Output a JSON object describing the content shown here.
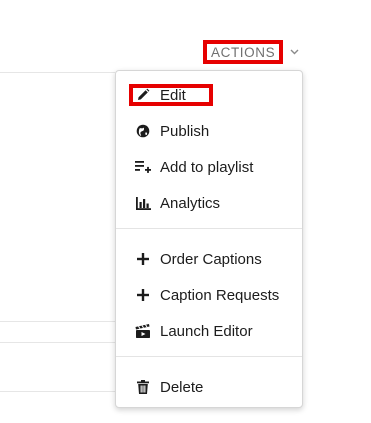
{
  "header": {
    "actions_label": "Actions"
  },
  "menu": {
    "items": [
      {
        "label": "Edit",
        "icon": "pencil-icon"
      },
      {
        "label": "Publish",
        "icon": "globe-icon"
      },
      {
        "label": "Add to playlist",
        "icon": "playlist-add-icon"
      },
      {
        "label": "Analytics",
        "icon": "bar-chart-icon"
      },
      {
        "label": "Order Captions",
        "icon": "plus-icon"
      },
      {
        "label": "Caption Requests",
        "icon": "plus-icon"
      },
      {
        "label": "Launch Editor",
        "icon": "clapperboard-icon"
      },
      {
        "label": "Delete",
        "icon": "trash-icon"
      }
    ]
  },
  "colors": {
    "highlight": "#e60000",
    "text": "#1c1c1c",
    "muted": "#707070"
  }
}
